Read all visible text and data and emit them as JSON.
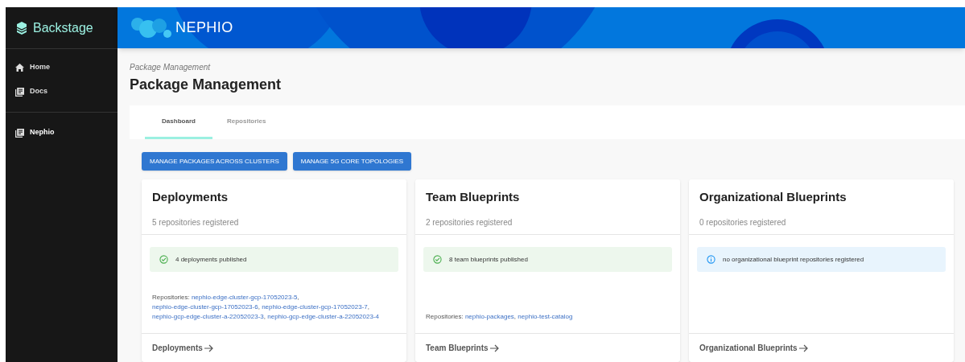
{
  "sidebar": {
    "brand": "Backstage",
    "items": [
      {
        "label": "Home",
        "selected": false
      },
      {
        "label": "Docs",
        "selected": false
      },
      {
        "label": "Nephio",
        "selected": true
      }
    ]
  },
  "header": {
    "logo_text": "NEPHIO"
  },
  "breadcrumb": "Package Management",
  "title": "Package Management",
  "tabs": [
    {
      "label": "Dashboard",
      "selected": true
    },
    {
      "label": "Repositories",
      "selected": false
    }
  ],
  "buttons": [
    "MANAGE PACKAGES ACROSS CLUSTERS",
    "MANAGE 5G CORE TOPOLOGIES"
  ],
  "cards": [
    {
      "title": "Deployments",
      "subtitle": "5 repositories registered",
      "alert": {
        "kind": "success",
        "text": "4 deployments published"
      },
      "repositories_label": "Repositories:",
      "repositories": [
        {
          "name": "nephio-edge-cluster-gcp-17052023-5",
          "suffix": ","
        },
        {
          "name": "nephio-edge-cluster-gcp-17052023-6",
          "suffix": ","
        },
        {
          "name": "nephio-edge-cluster-gcp-17052023-7",
          "suffix": ","
        },
        {
          "name": "nephio-gcp-edge-cluster-a-22052023-3",
          "suffix": ","
        },
        {
          "name": "nephio-gcp-edge-cluster-a-22052023-4"
        }
      ],
      "footer_link": "Deployments"
    },
    {
      "title": "Team Blueprints",
      "subtitle": "2 repositories registered",
      "alert": {
        "kind": "success",
        "text": "8 team blueprints published"
      },
      "repositories_label": "Repositories:",
      "repositories": [
        {
          "name": "nephio-packages",
          "suffix": ","
        },
        {
          "name": "nephio-test-catalog"
        }
      ],
      "footer_link": "Team Blueprints"
    },
    {
      "title": "Organizational Blueprints",
      "subtitle": "0 repositories registered",
      "alert": {
        "kind": "info",
        "text": "no organizational blueprint repositories registered"
      },
      "footer_link": "Organizational Blueprints"
    }
  ]
}
